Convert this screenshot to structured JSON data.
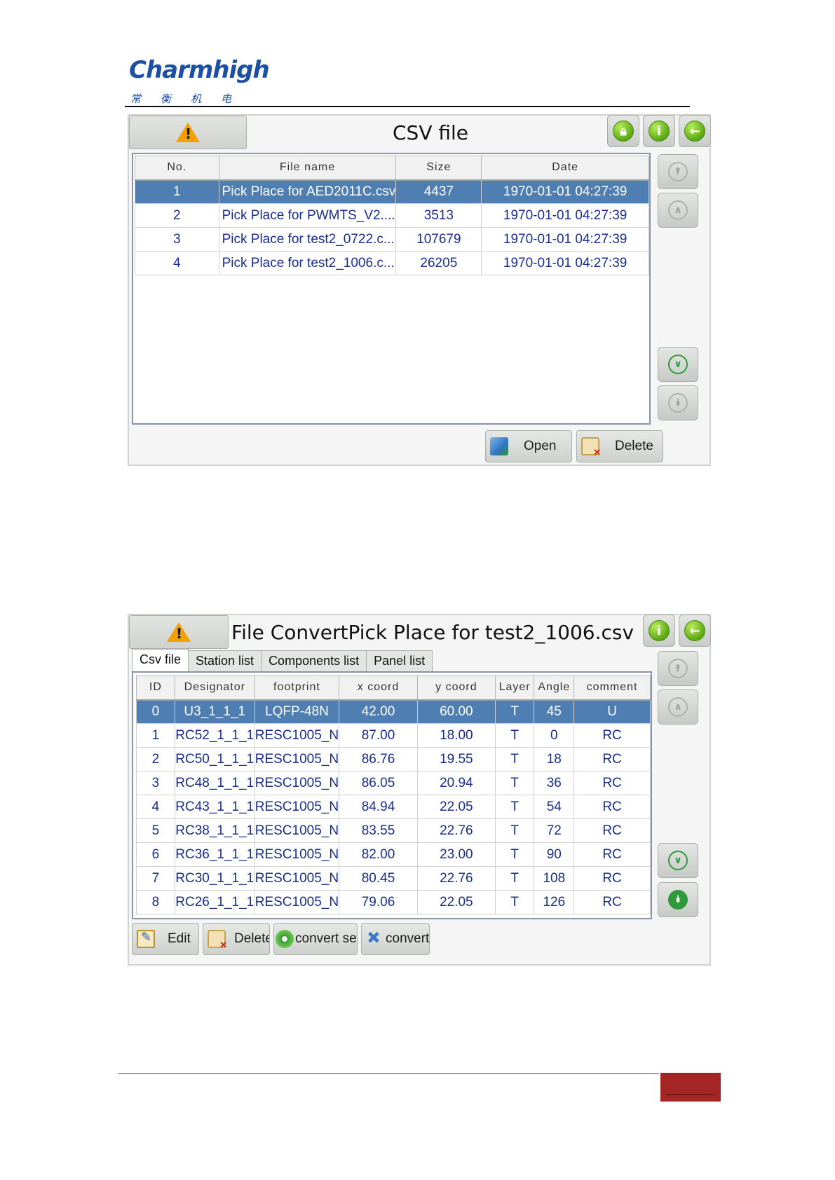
{
  "logo": {
    "latin": "Charmhigh",
    "chinese": "常衡机电"
  },
  "panel1": {
    "title": "CSV file",
    "header_buttons": [
      "lock-icon",
      "info-icon",
      "back-arrow-icon"
    ],
    "columns": [
      "No.",
      "File name",
      "Size",
      "Date"
    ],
    "rows": [
      {
        "no": "1",
        "name": "Pick Place for AED2011C.csv",
        "size": "4437",
        "date": "1970-01-01 04:27:39",
        "selected": true
      },
      {
        "no": "2",
        "name": "Pick Place for PWMTS_V2....",
        "size": "3513",
        "date": "1970-01-01 04:27:39"
      },
      {
        "no": "3",
        "name": "Pick Place for test2_0722.c...",
        "size": "107679",
        "date": "1970-01-01 04:27:39"
      },
      {
        "no": "4",
        "name": "Pick Place for test2_1006.c...",
        "size": "26205",
        "date": "1970-01-01 04:27:39"
      }
    ],
    "open_label": "Open",
    "delete_label": "Delete"
  },
  "panel2": {
    "title": "File ConvertPick Place for test2_1006.csv",
    "tabs": [
      "Csv file",
      "Station list",
      "Components list",
      "Panel list"
    ],
    "active_tab": "Csv file",
    "columns": [
      "ID",
      "Designator",
      "footprint",
      "x coord",
      "y coord",
      "Layer",
      "Angle",
      "comment"
    ],
    "rows": [
      [
        "0",
        "U3_1_1_1",
        "LQFP-48N",
        "42.00",
        "60.00",
        "T",
        "45",
        "U"
      ],
      [
        "1",
        "RC52_1_1_1",
        "RESC1005_N",
        "87.00",
        "18.00",
        "T",
        "0",
        "RC"
      ],
      [
        "2",
        "RC50_1_1_1",
        "RESC1005_N",
        "86.76",
        "19.55",
        "T",
        "18",
        "RC"
      ],
      [
        "3",
        "RC48_1_1_1",
        "RESC1005_N",
        "86.05",
        "20.94",
        "T",
        "36",
        "RC"
      ],
      [
        "4",
        "RC43_1_1_1",
        "RESC1005_N",
        "84.94",
        "22.05",
        "T",
        "54",
        "RC"
      ],
      [
        "5",
        "RC38_1_1_1",
        "RESC1005_N",
        "83.55",
        "22.76",
        "T",
        "72",
        "RC"
      ],
      [
        "6",
        "RC36_1_1_1",
        "RESC1005_N",
        "82.00",
        "23.00",
        "T",
        "90",
        "RC"
      ],
      [
        "7",
        "RC30_1_1_1",
        "RESC1005_N",
        "80.45",
        "22.76",
        "T",
        "108",
        "RC"
      ],
      [
        "8",
        "RC26_1_1_1",
        "RESC1005_N",
        "79.06",
        "22.05",
        "T",
        "126",
        "RC"
      ]
    ],
    "selected_row": "0",
    "edit_label": "Edit",
    "delete_label": "Delete",
    "convert_set_label": "convert set",
    "convert_label": "convert"
  },
  "colors": {
    "selected_row": "#4f7eb2",
    "cell_text": "#1a2d8c",
    "page_tab": "#a52525",
    "logo": "#1d4fa3"
  }
}
